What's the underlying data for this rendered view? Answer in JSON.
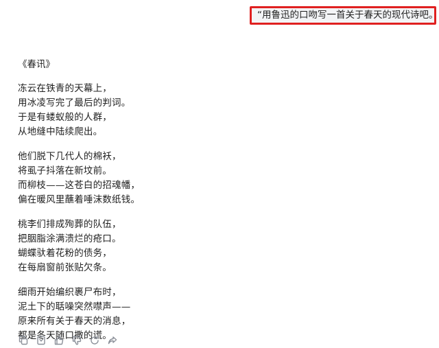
{
  "user_message": {
    "text": "“用鲁迅的口吻写一首关于春天的现代诗吧。”"
  },
  "reply": {
    "title": "《春讯》",
    "stanzas": [
      {
        "lines": [
          "冻云在铁青的天幕上，",
          "用冰凌写完了最后的判词。",
          "于是有蝼蚁般的人群，",
          "从地缝中陆续爬出。"
        ]
      },
      {
        "lines": [
          "他们脱下几代人的棉袄，",
          "将虱子抖落在新坟前。",
          "而柳枝——这苍白的招魂幡，",
          "偏在暖风里蘸着唾沫数纸钱。"
        ]
      },
      {
        "lines": [
          "桃李们排成殉葬的队伍，",
          "把胭脂涂满溃烂的疮口。",
          "蝴蝶驮着花粉的债务，",
          "在每扇窗前张贴欠条。"
        ]
      },
      {
        "lines": [
          "细雨开始编织裹尸布时，",
          "泥土下的聒噪突然噤声——",
          "原来所有关于春天的消息，",
          "都是冬天随口撒的谎。"
        ]
      }
    ]
  },
  "actions": [
    {
      "icon": "copy-icon"
    },
    {
      "icon": "bookmark-icon"
    },
    {
      "icon": "thumbs-up-icon"
    },
    {
      "icon": "thumbs-down-icon"
    },
    {
      "icon": "refresh-icon"
    },
    {
      "icon": "share-icon"
    }
  ]
}
